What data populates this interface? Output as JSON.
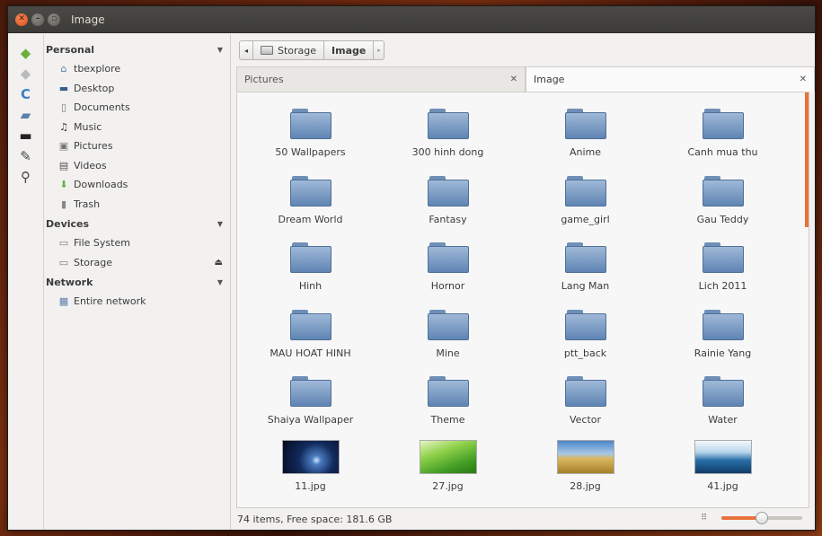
{
  "window": {
    "title": "Image"
  },
  "colors": {
    "accent": "#e8733a",
    "folder": "#7a9cc6",
    "titlebar": "#3c3b37"
  },
  "strip_icons": [
    "go-back-icon",
    "go-forward-icon",
    "reload-icon",
    "places-icon",
    "computer-icon",
    "edit-icon",
    "search-icon"
  ],
  "sidebar": {
    "sections": [
      {
        "header": "Personal",
        "items": [
          {
            "label": "tbexplore",
            "icon": "home-icon"
          },
          {
            "label": "Desktop",
            "icon": "desktop-icon"
          },
          {
            "label": "Documents",
            "icon": "documents-icon"
          },
          {
            "label": "Music",
            "icon": "music-icon"
          },
          {
            "label": "Pictures",
            "icon": "pictures-icon"
          },
          {
            "label": "Videos",
            "icon": "videos-icon"
          },
          {
            "label": "Downloads",
            "icon": "downloads-icon"
          },
          {
            "label": "Trash",
            "icon": "trash-icon"
          }
        ]
      },
      {
        "header": "Devices",
        "items": [
          {
            "label": "File System",
            "icon": "drive-icon"
          },
          {
            "label": "Storage",
            "icon": "drive-icon",
            "eject": true
          }
        ]
      },
      {
        "header": "Network",
        "items": [
          {
            "label": "Entire network",
            "icon": "network-icon"
          }
        ]
      }
    ]
  },
  "pathbar": {
    "crumbs": [
      "Storage",
      "Image"
    ]
  },
  "tabs": [
    {
      "label": "Pictures",
      "active": false
    },
    {
      "label": "Image",
      "active": true
    }
  ],
  "files": [
    {
      "name": "50 Wallpapers",
      "type": "folder"
    },
    {
      "name": "300 hinh dong",
      "type": "folder"
    },
    {
      "name": "Anime",
      "type": "folder"
    },
    {
      "name": "Canh mua thu",
      "type": "folder"
    },
    {
      "name": "Dream World",
      "type": "folder"
    },
    {
      "name": "Fantasy",
      "type": "folder"
    },
    {
      "name": "game_girl",
      "type": "folder"
    },
    {
      "name": "Gau Teddy",
      "type": "folder"
    },
    {
      "name": "Hinh",
      "type": "folder"
    },
    {
      "name": "Hornor",
      "type": "folder"
    },
    {
      "name": "Lang Man",
      "type": "folder"
    },
    {
      "name": "Lich 2011",
      "type": "folder"
    },
    {
      "name": "MAU HOAT HINH",
      "type": "folder"
    },
    {
      "name": "Mine",
      "type": "folder"
    },
    {
      "name": "ptt_back",
      "type": "folder"
    },
    {
      "name": "Rainie Yang",
      "type": "folder"
    },
    {
      "name": "Shaiya Wallpaper",
      "type": "folder"
    },
    {
      "name": "Theme",
      "type": "folder"
    },
    {
      "name": "Vector",
      "type": "folder"
    },
    {
      "name": "Water",
      "type": "folder"
    },
    {
      "name": "11.jpg",
      "type": "image",
      "thumb": "night-sky"
    },
    {
      "name": "27.jpg",
      "type": "image",
      "thumb": "green-field"
    },
    {
      "name": "28.jpg",
      "type": "image",
      "thumb": "wheat-field"
    },
    {
      "name": "41.jpg",
      "type": "image",
      "thumb": "ocean-sky"
    }
  ],
  "status": {
    "text": "74 items, Free space: 181.6 GB",
    "zoom_level": 0.5
  }
}
